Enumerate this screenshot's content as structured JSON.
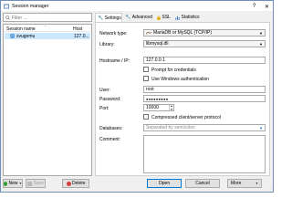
{
  "window": {
    "title": "Session manager",
    "close_glyph": "✕",
    "help_glyph": "?"
  },
  "filter": {
    "placeholder": "Filter ..."
  },
  "tree": {
    "col_session": "Session name",
    "col_host": "Host",
    "sort_glyph": "⌃",
    "rows": [
      {
        "name": "svugemu",
        "host": "127.0..."
      }
    ]
  },
  "tabs": [
    {
      "label": "Settings",
      "icon": "wrench-icon",
      "active": true
    },
    {
      "label": "Advanced",
      "icon": "wrench-icon",
      "active": false
    },
    {
      "label": "SSL",
      "icon": "lock-icon",
      "active": false
    },
    {
      "label": "Statistics",
      "icon": "chart-icon",
      "active": false
    }
  ],
  "settings": {
    "network_type_label": "Network type:",
    "network_type_value": "MariaDB or MySQL (TCP/IP)",
    "library_label": "Library:",
    "library_value": "libmysql.dll",
    "hostname_label": "Hostname / IP:",
    "hostname_value": "127.0.0.1",
    "prompt_label": "Prompt for credentials",
    "prompt_checked": false,
    "windows_auth_label": "Use Windows authentication",
    "windows_auth_checked": false,
    "user_label": "User:",
    "user_value": "root",
    "password_label": "Password:",
    "password_value": "●●●●●●●●●",
    "port_label": "Port:",
    "port_value": "10000",
    "compressed_label": "Compressed client/server protocol",
    "compressed_checked": false,
    "databases_label": "Databases:",
    "databases_placeholder": "Separated by semicolon",
    "comment_label": "Comment:"
  },
  "buttons": {
    "new": "New",
    "save": "Save",
    "delete": "Delete",
    "open": "Open",
    "cancel": "Cancel",
    "more": "More"
  },
  "colors": {
    "selection": "#cce8ff",
    "accent": "#0078d7",
    "new_icon": "#2e9e2e",
    "delete_icon": "#d83b3b",
    "title_border": "#6e8fb7"
  }
}
